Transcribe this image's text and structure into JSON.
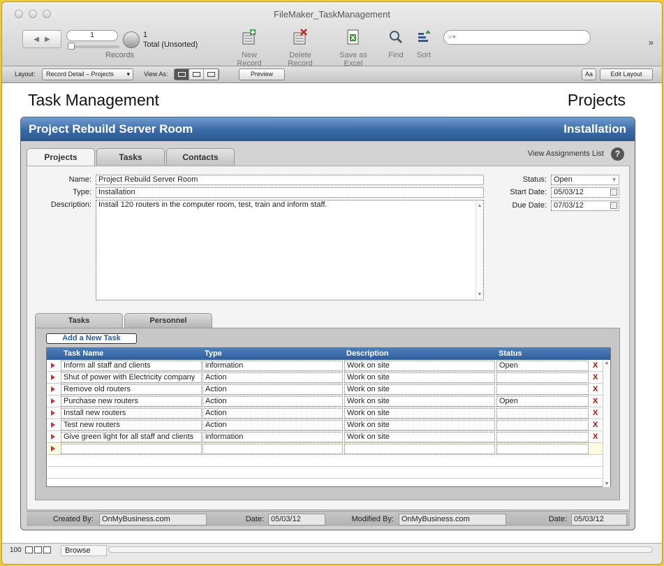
{
  "window": {
    "title": "FileMaker_TaskManagement"
  },
  "toolbar": {
    "record_current": "1",
    "record_count": "1",
    "record_status": "Total (Unsorted)",
    "records_label": "Records",
    "new_record": "New Record",
    "delete_record": "Delete Record",
    "save_excel": "Save as Excel",
    "find": "Find",
    "sort": "Sort",
    "search_placeholder": "",
    "more": "»"
  },
  "layoutbar": {
    "layout_label": "Layout:",
    "layout_value": "Record Detail – Projects",
    "view_as_label": "View As:",
    "preview": "Preview",
    "aa": "Aa",
    "edit_layout": "Edit Layout"
  },
  "page": {
    "title": "Task Management",
    "section": "Projects"
  },
  "project": {
    "header_name": "Project Rebuild Server Room",
    "header_type": "Installation",
    "tabs": [
      "Projects",
      "Tasks",
      "Contacts"
    ],
    "view_assignments": "View Assignments List",
    "help": "?",
    "name_label": "Name:",
    "name": "Project Rebuild Server Room",
    "type_label": "Type:",
    "type": "Installation",
    "description_label": "Description:",
    "description": "Install 120 routers in the computer room, test, train and inform staff.",
    "status_label": "Status:",
    "status": "Open",
    "start_date_label": "Start Date:",
    "start_date": "05/03/12",
    "due_date_label": "Due Date:",
    "due_date": "07/03/12"
  },
  "subtabs": [
    "Tasks",
    "Personnel"
  ],
  "tasks": {
    "add_button": "Add a New Task",
    "columns": [
      "Task Name",
      "Type",
      "Description",
      "Status"
    ],
    "rows": [
      {
        "name": "Inform all staff and clients",
        "type": "information",
        "description": "Work on site",
        "status": "Open"
      },
      {
        "name": "Shut of power with Electricity company",
        "type": "Action",
        "description": "Work on site",
        "status": ""
      },
      {
        "name": "Remove old routers",
        "type": "Action",
        "description": "Work on site",
        "status": ""
      },
      {
        "name": "Purchase new routers",
        "type": "Action",
        "description": "Work on site",
        "status": "Open"
      },
      {
        "name": "Install new routers",
        "type": "Action",
        "description": "Work on site",
        "status": ""
      },
      {
        "name": "Test new routers",
        "type": "Action",
        "description": "Work on site",
        "status": ""
      },
      {
        "name": "Give green light for all staff and clients",
        "type": "information",
        "description": "Work on site",
        "status": ""
      }
    ],
    "delete_glyph": "X"
  },
  "footer": {
    "created_by_label": "Created By:",
    "created_by": "OnMyBusiness.com",
    "date_label": "Date:",
    "created_date": "05/03/12",
    "modified_by_label": "Modified By:",
    "modified_by": "OnMyBusiness.com",
    "modified_date": "05/03/12"
  },
  "statusbar": {
    "zoom": "100",
    "mode": "Browse"
  },
  "colors": {
    "header_blue": "#3a6aa5",
    "delete_red": "#cc0000",
    "window_bg": "#f0c93a"
  }
}
